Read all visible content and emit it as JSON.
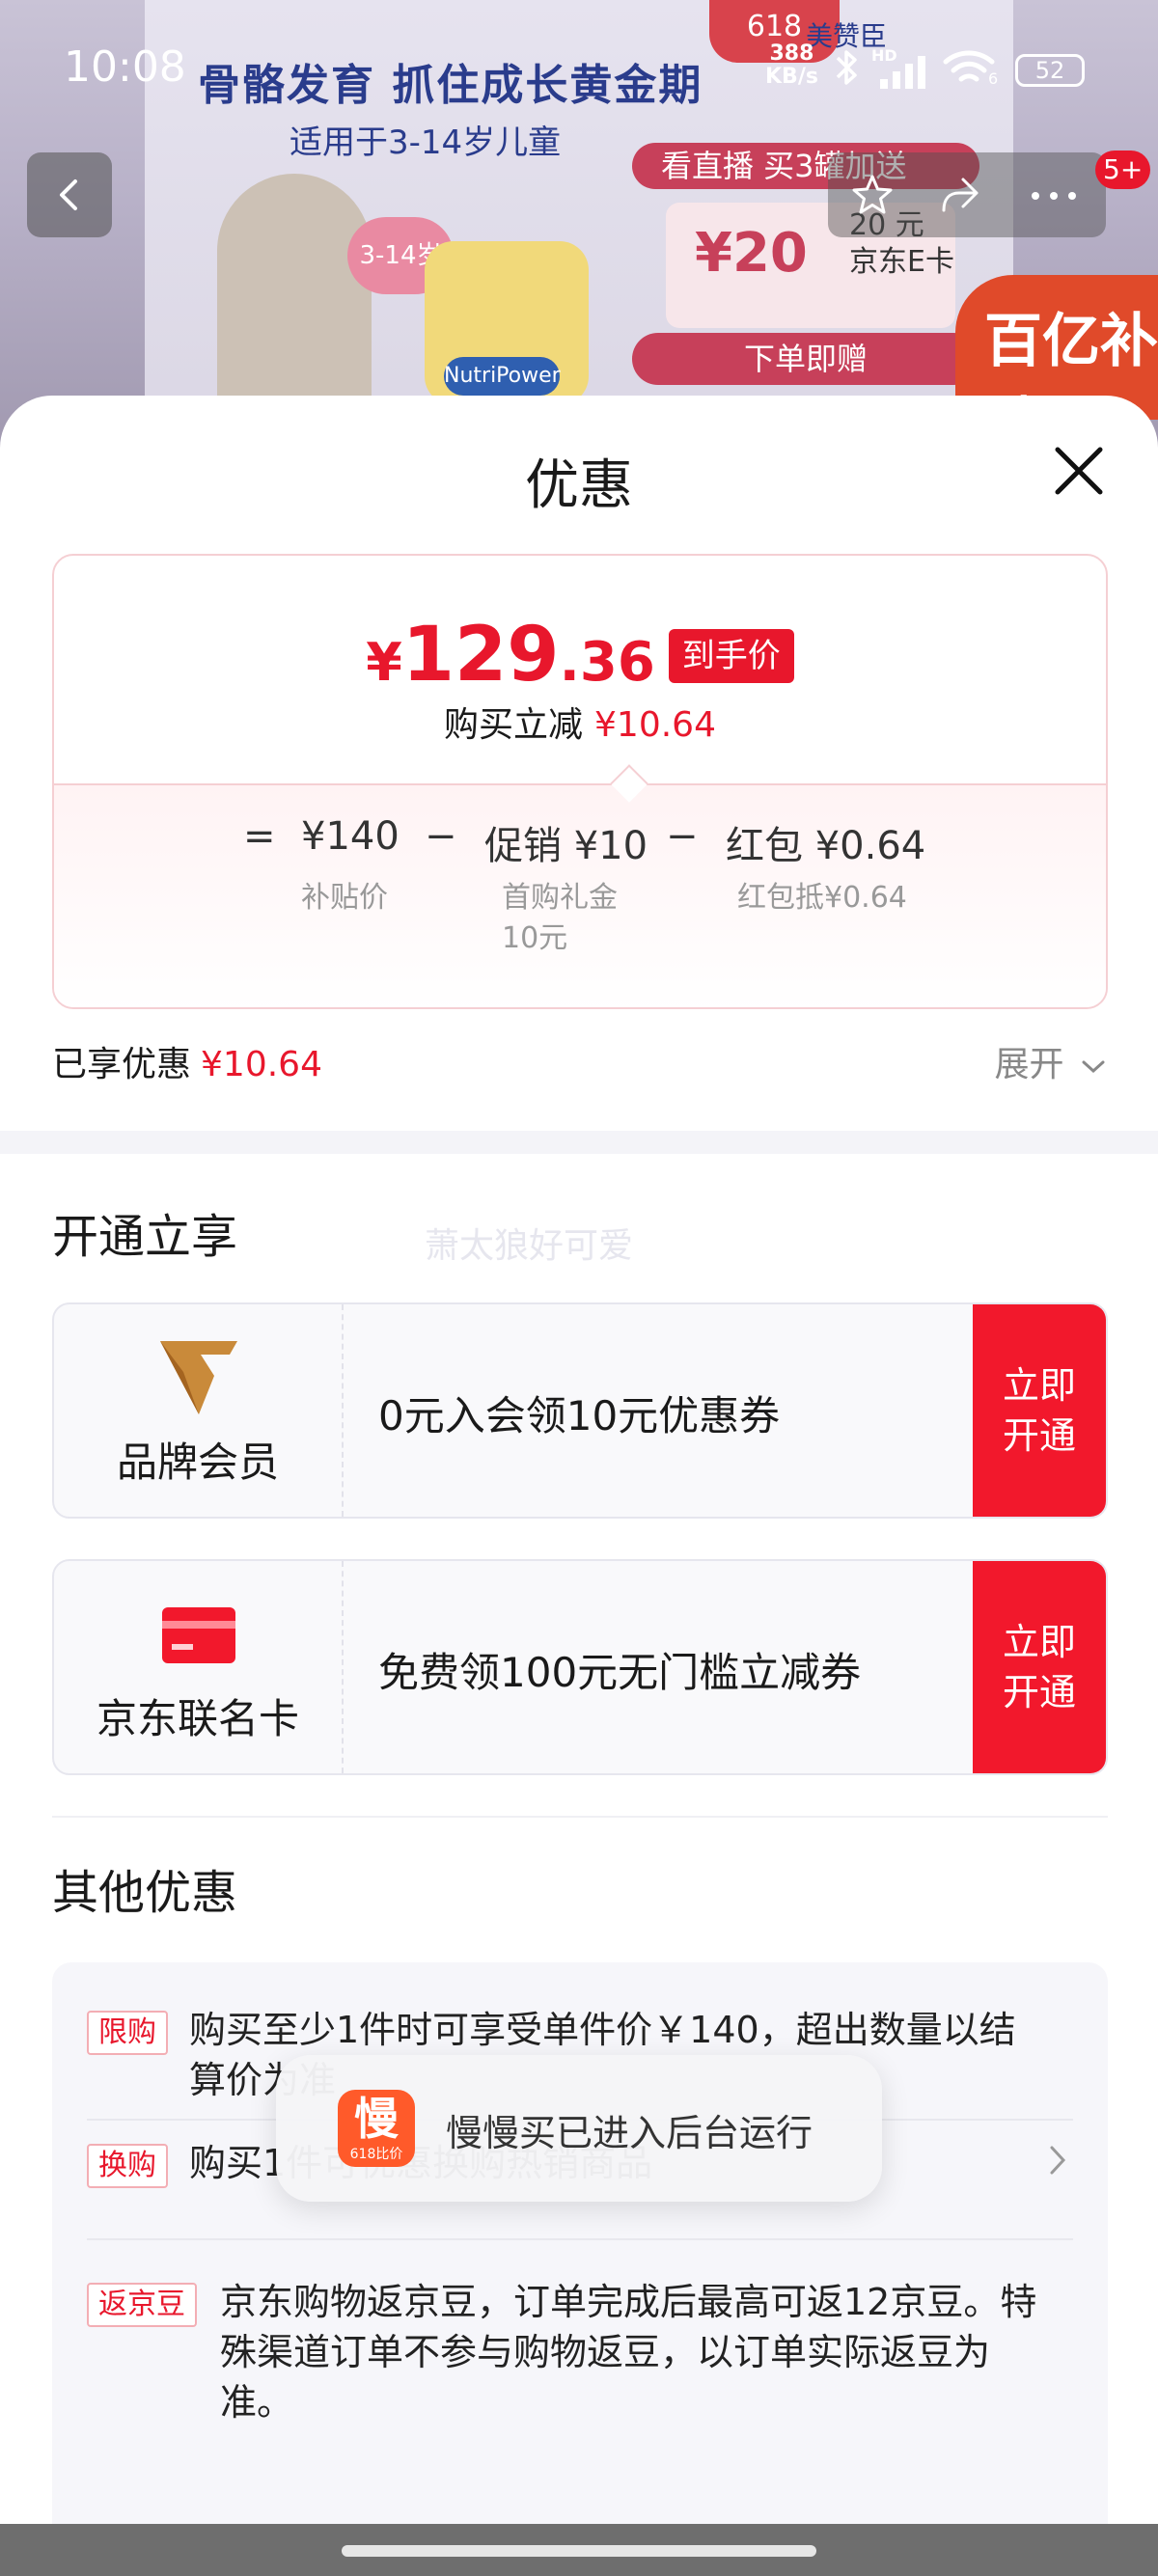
{
  "status_bar": {
    "time": "10:08",
    "net_speed_value": "388",
    "net_speed_unit": "KB/s",
    "network": "HD",
    "wifi_level": "6",
    "battery": "52"
  },
  "banner": {
    "headline": "骨骼发育 抓住成长黄金期",
    "subtitle": "适用于3-14岁儿童",
    "age_badge": "3-14岁",
    "can_label": "NutriPower",
    "live_text": "看直播 买3罐加送",
    "card_amount": "¥20",
    "card_desc_line1": "20 元",
    "card_desc_line2": "京东E卡",
    "order_gift": "下单即赠",
    "promo_logo": "618",
    "brand": "美赞臣",
    "subsidy_tag": "百亿补贴",
    "cart_badge": "5+"
  },
  "sheet": {
    "title": "优惠",
    "price": {
      "yen": "¥",
      "integer": "129",
      "decimal": ".36",
      "tag": "到手价",
      "reduction_label": "购买立减",
      "reduction_amount": "¥10.64"
    },
    "formula": {
      "equals": "=",
      "base": "¥140",
      "base_label": "补贴价",
      "minus1": "−",
      "promo": "促销 ¥10",
      "promo_label_line1": "首购礼金",
      "promo_label_line2": "10元",
      "minus2": "−",
      "redpack": "红包 ¥0.64",
      "redpack_label": "红包抵¥0.64"
    },
    "enjoyed_label": "已享优惠",
    "enjoyed_amount": "¥10.64",
    "expand_label": "展开",
    "open_section": {
      "title": "开通立享",
      "watermark": "萧太狼好可爱",
      "offers": [
        {
          "name": "品牌会员",
          "desc": "0元入会领10元优惠券",
          "button": "立即开通"
        },
        {
          "name": "京东联名卡",
          "desc": "免费领100元无门槛立减券",
          "button": "立即开通"
        }
      ]
    },
    "other_section": {
      "title": "其他优惠",
      "rows": [
        {
          "tag": "限购",
          "text": "购买至少1件时可享受单件价￥140，超出数量以结算价为准"
        },
        {
          "tag": "换购",
          "text": "购买1件可优惠换购热销商品"
        },
        {
          "tag": "返京豆",
          "text": "京东购物返京豆，订单完成后最高可返12京豆。特殊渠道订单不参与购物返豆，以订单实际返豆为准。"
        }
      ]
    }
  },
  "toast": {
    "app_icon_text": "慢",
    "app_icon_sub": "618比价",
    "message": "慢慢买已进入后台运行"
  },
  "colors": {
    "accent_red": "#e8172c",
    "button_red": "#f2182c",
    "brand_gold": "#c98a3a"
  }
}
